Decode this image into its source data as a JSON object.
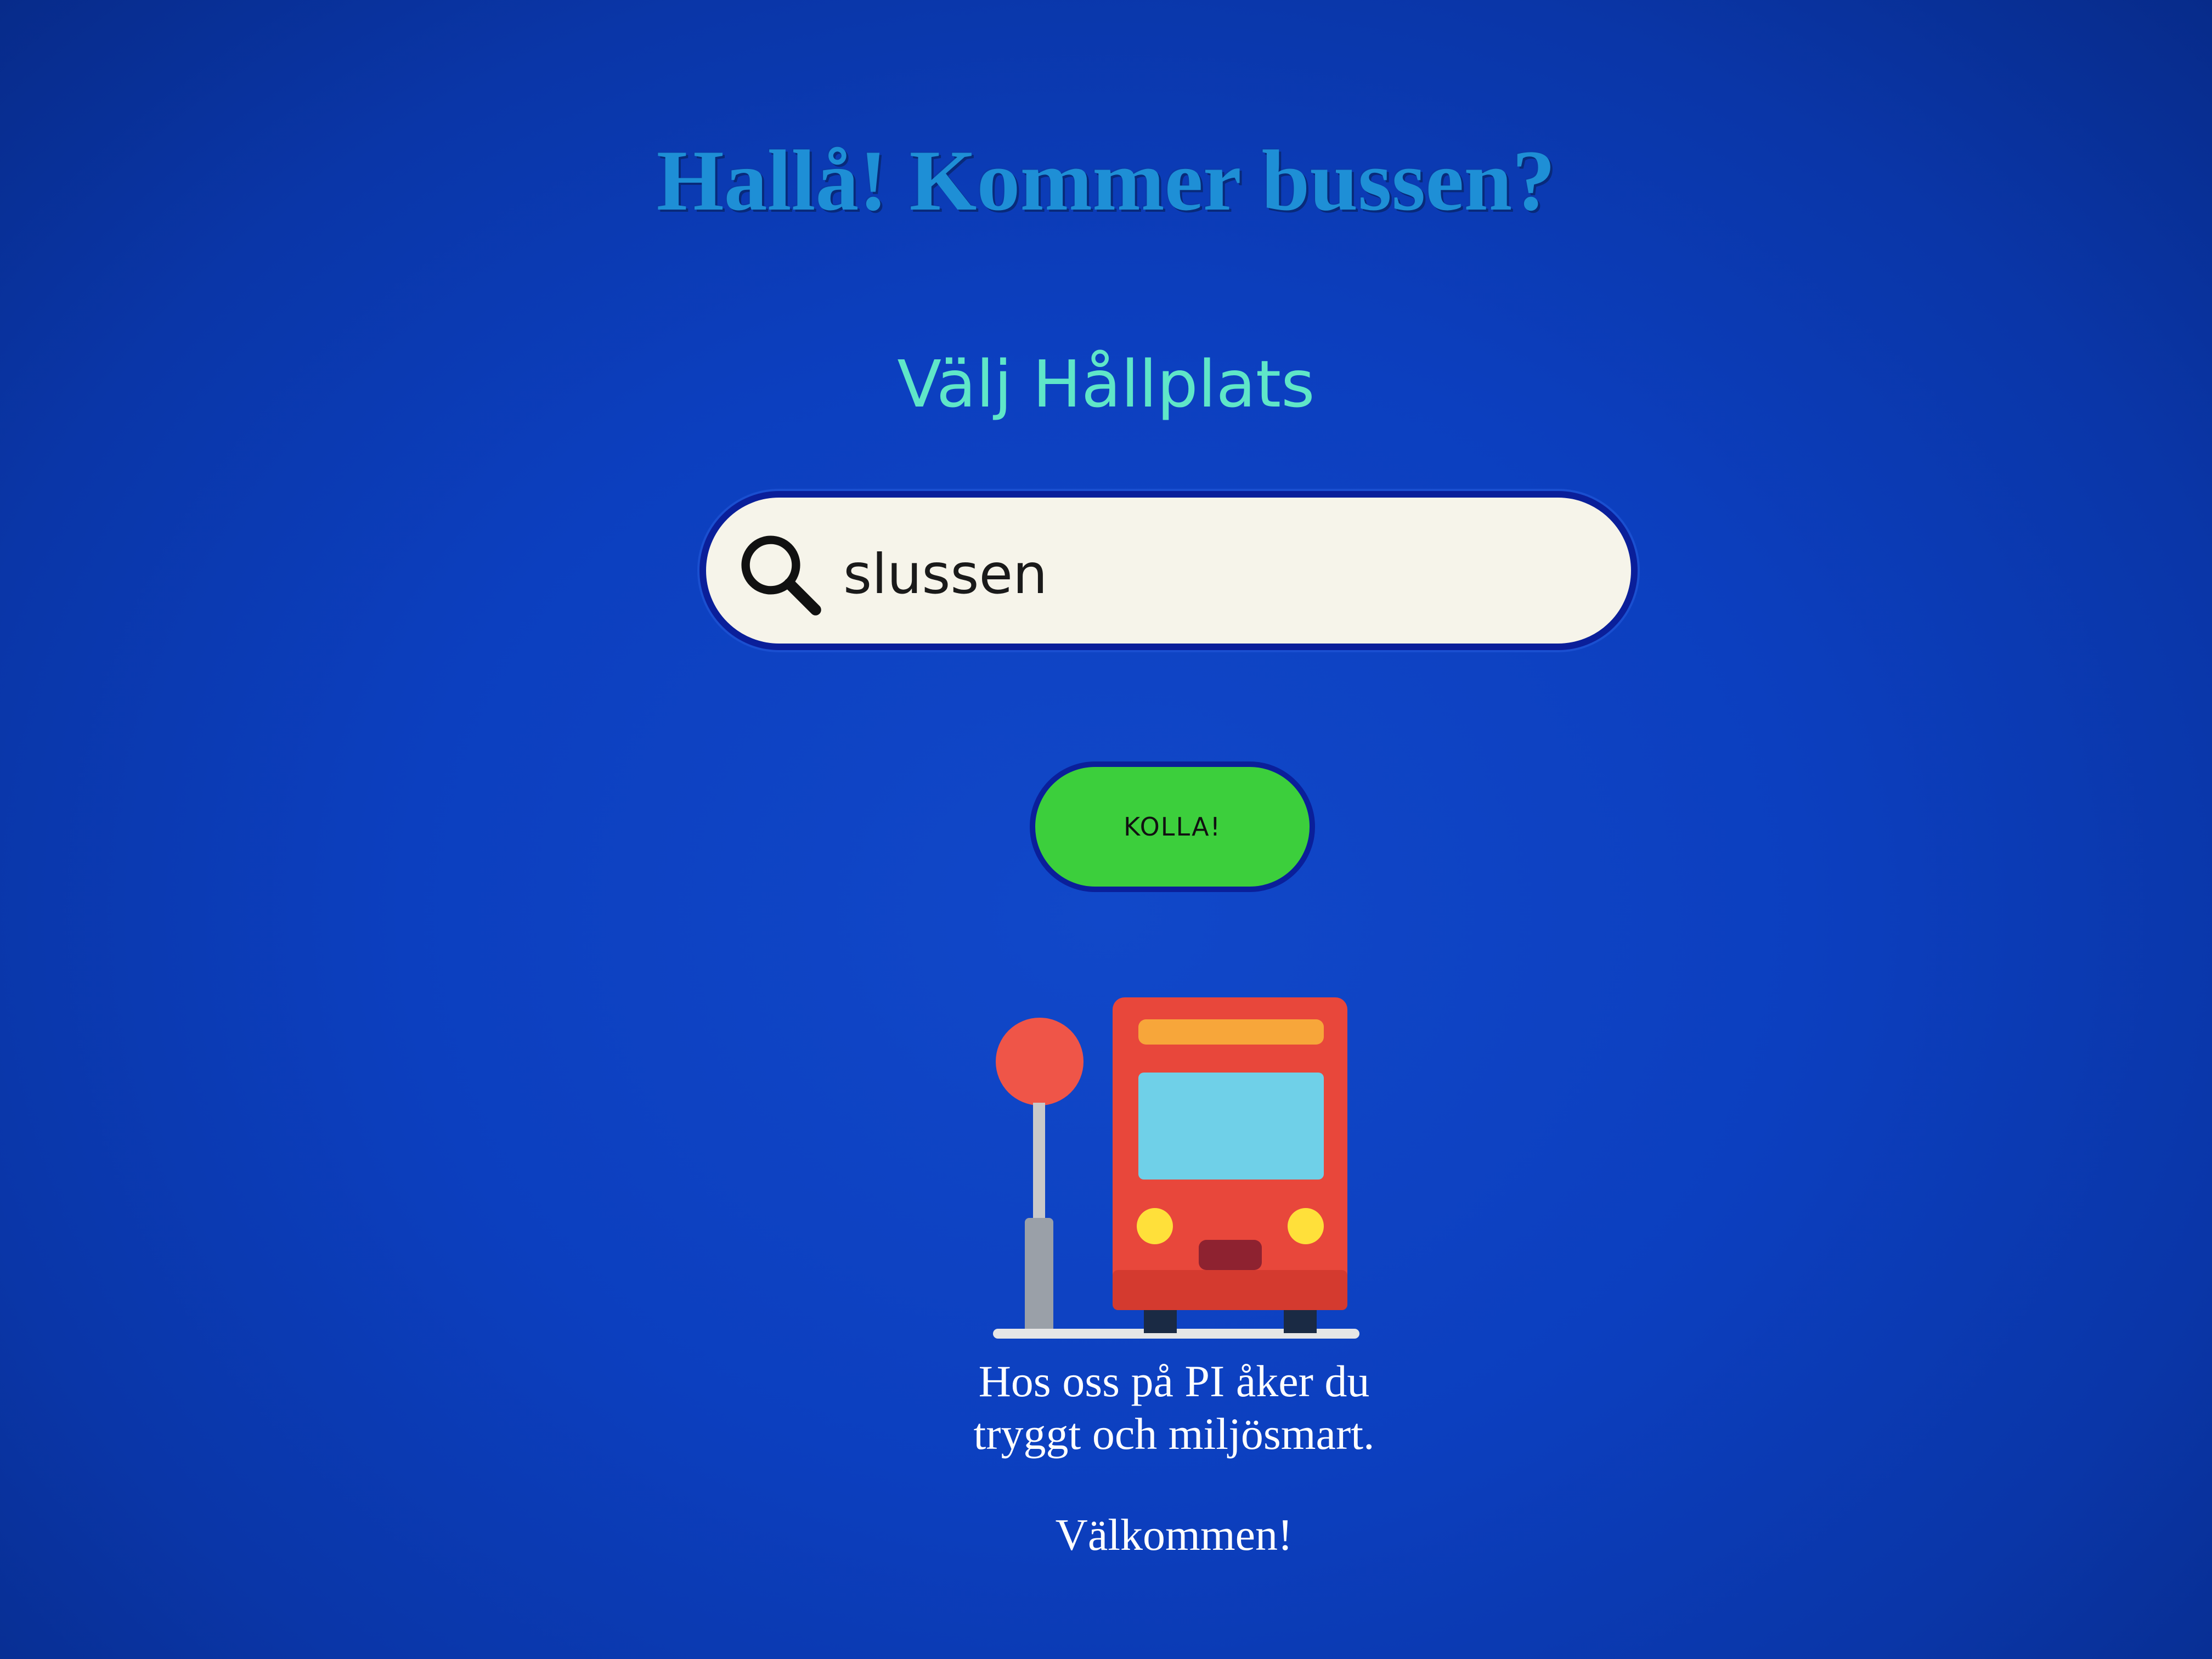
{
  "header": {
    "title": "Hallå! Kommer bussen?",
    "subtitle": "Välj Hållplats"
  },
  "search": {
    "icon": "search-icon",
    "value": "slussen"
  },
  "actions": {
    "check_label": "KOLLA!"
  },
  "illustration": {
    "icon": "bus-stop-icon",
    "colors": {
      "bus": "#e8473b",
      "sign": "#ef5548",
      "window": "#6fd0e8",
      "lights": "#ffe03a",
      "pole": "#c7c7c7"
    }
  },
  "footer": {
    "tagline_line1": "Hos oss på PI åker du",
    "tagline_line2": "tryggt och miljösmart.",
    "welcome": "Välkommen!"
  },
  "theme": {
    "background": "#0c3fbf",
    "title_color": "#1e8fd6",
    "subtitle_color": "#5fe6c8",
    "button_color": "#3ccf3c",
    "search_bg": "#f6f4ea"
  }
}
